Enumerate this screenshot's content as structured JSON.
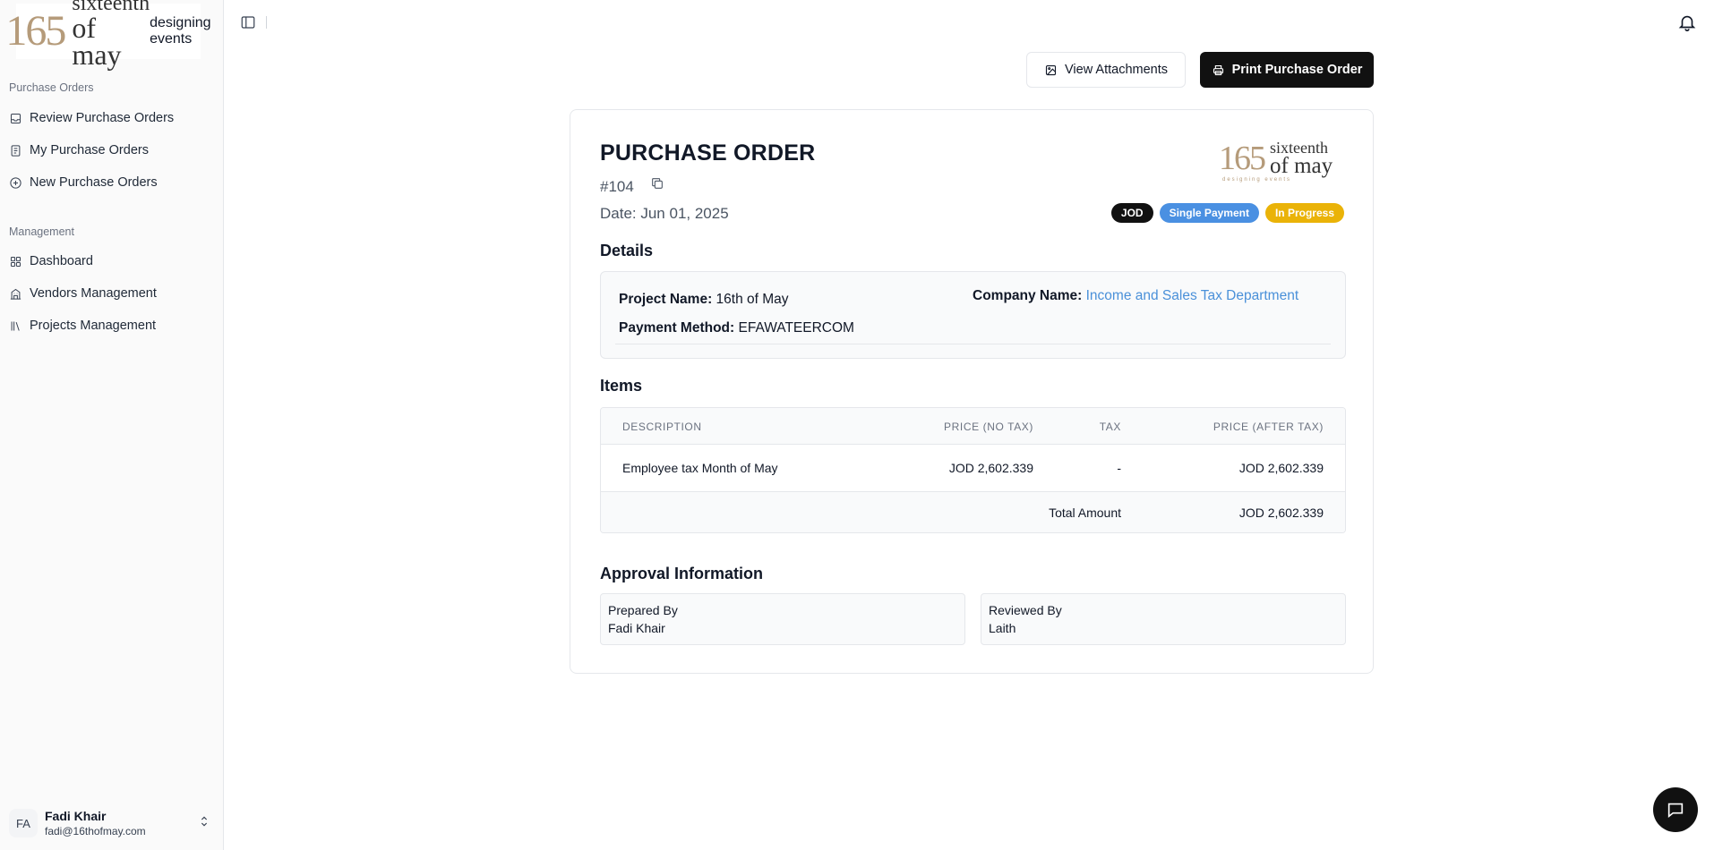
{
  "sidebar": {
    "logo": {
      "num": "165",
      "line1": "sixteenth",
      "line2": "of may",
      "tagline": "designing events"
    },
    "sections": [
      {
        "title": "Purchase Orders",
        "items": [
          {
            "label": "Review Purchase Orders",
            "icon": "inbox-icon"
          },
          {
            "label": "My Purchase Orders",
            "icon": "document-icon"
          },
          {
            "label": "New Purchase Orders",
            "icon": "plus-circle-icon"
          }
        ]
      },
      {
        "title": "Management",
        "items": [
          {
            "label": "Dashboard",
            "icon": "grid-icon"
          },
          {
            "label": "Vendors Management",
            "icon": "building-icon"
          },
          {
            "label": "Projects Management",
            "icon": "library-icon"
          }
        ]
      }
    ],
    "user": {
      "initials": "FA",
      "name": "Fadi Khair",
      "email": "fadi@16thofmay.com"
    }
  },
  "actions": {
    "view_attachments": "View Attachments",
    "print": "Print Purchase Order"
  },
  "order": {
    "title": "PURCHASE ORDER",
    "number": "#104",
    "date": "Date: Jun 01, 2025",
    "logo": {
      "num": "165",
      "line1": "sixteenth",
      "line2": "of may",
      "tagline": "designing events"
    },
    "badges": [
      {
        "label": "JOD",
        "color": "#111111"
      },
      {
        "label": "Single Payment",
        "color": "#4a90e2"
      },
      {
        "label": "In Progress",
        "color": "#eab308"
      }
    ],
    "details_heading": "Details",
    "details": {
      "project_label": "Project Name:",
      "project_value": "16th of May",
      "payment_label": "Payment Method:",
      "payment_value": "EFAWATEERCOM",
      "company_label": "Company Name:",
      "company_value": "Income and Sales Tax Department"
    },
    "items_heading": "Items",
    "table": {
      "headers": [
        "DESCRIPTION",
        "PRICE (NO TAX)",
        "TAX",
        "PRICE (AFTER TAX)"
      ],
      "rows": [
        [
          "Employee tax Month of May",
          "JOD 2,602.339",
          "-",
          "JOD 2,602.339"
        ]
      ],
      "total_label": "Total Amount",
      "total_value": "JOD 2,602.339"
    },
    "approval_heading": "Approval Information",
    "approval": {
      "prepared_label": "Prepared By",
      "prepared_value": "Fadi Khair",
      "reviewed_label": "Reviewed By",
      "reviewed_value": "Laith"
    }
  }
}
